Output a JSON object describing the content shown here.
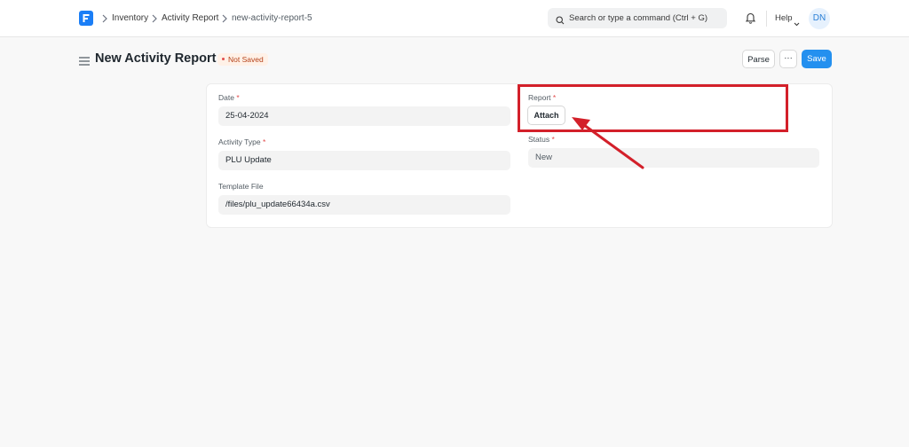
{
  "navbar": {
    "breadcrumbs": [
      "Inventory",
      "Activity Report",
      "new-activity-report-5"
    ],
    "search_placeholder": "Search or type a command (Ctrl + G)",
    "help_label": "Help",
    "avatar_initials": "DN"
  },
  "page": {
    "title": "New Activity Report",
    "status_badge": "Not Saved",
    "buttons": {
      "parse": "Parse",
      "more": "···",
      "save": "Save"
    }
  },
  "form": {
    "date": {
      "label": "Date",
      "required": "*",
      "value": "25-04-2024"
    },
    "activity_type": {
      "label": "Activity Type",
      "required": "*",
      "value": "PLU Update"
    },
    "template_file": {
      "label": "Template File",
      "value": "/files/plu_update66434a.csv"
    },
    "report": {
      "label": "Report",
      "required": "*",
      "button_label": "Attach"
    },
    "status": {
      "label": "Status",
      "required": "*",
      "value": "New"
    }
  },
  "colors": {
    "primary": "#2490ef",
    "annotation": "#d3202a",
    "logo": "#1b7ef6"
  },
  "icons": [
    "frappe-logo-icon",
    "chevron-right-icon",
    "search-icon",
    "bell-icon",
    "chevron-down-icon",
    "hamburger-menu-icon"
  ]
}
